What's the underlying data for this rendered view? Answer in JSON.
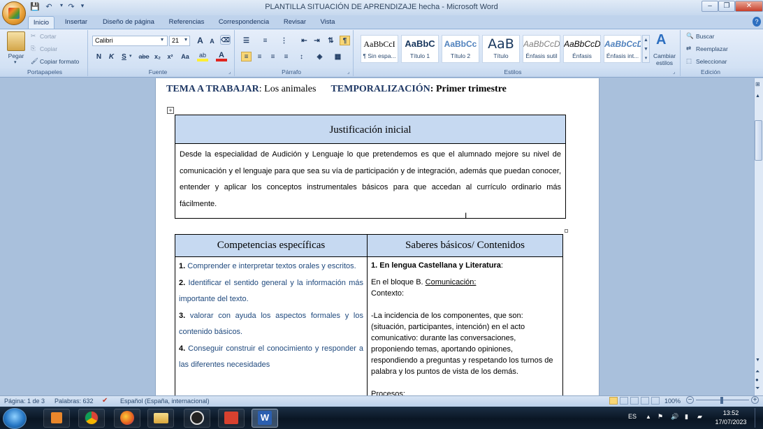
{
  "window": {
    "title": "PLANTILLA SITUACIÓN DE APRENDIZAJE hecha - Microsoft Word",
    "min_label": "–",
    "max_label": "❐",
    "close_label": "✕"
  },
  "tabs": [
    "Inicio",
    "Insertar",
    "Diseño de página",
    "Referencias",
    "Correspondencia",
    "Revisar",
    "Vista"
  ],
  "ribbon": {
    "portapapeles": {
      "paste": "Pegar",
      "cut": "Cortar",
      "copy": "Copiar",
      "format_painter": "Copiar formato",
      "label": "Portapapeles"
    },
    "fuente": {
      "font": "Calibri",
      "size": "21",
      "label": "Fuente",
      "bold": "N",
      "italic": "K",
      "underline": "S",
      "strike": "abe",
      "sub": "x₂",
      "sup": "x²",
      "case": "Aa",
      "grow": "A",
      "shrink": "A"
    },
    "parrafo": {
      "label": "Párrafo"
    },
    "estilos": {
      "label": "Estilos",
      "items": [
        {
          "preview": "AaBbCcI",
          "name": "¶ Sin espa..."
        },
        {
          "preview": "AaBbC",
          "name": "Título 1"
        },
        {
          "preview": "AaBbCc",
          "name": "Título 2"
        },
        {
          "preview": "AaB",
          "name": "Título"
        },
        {
          "preview": "AaBbCcD",
          "name": "Énfasis sutil"
        },
        {
          "preview": "AaBbCcD",
          "name": "Énfasis"
        },
        {
          "preview": "AaBbCcD",
          "name": "Énfasis int..."
        }
      ],
      "change_styles": "Cambiar estilos"
    },
    "edicion": {
      "find": "Buscar",
      "replace": "Reemplazar",
      "select": "Seleccionar",
      "label": "Edición"
    }
  },
  "document": {
    "header_line": {
      "topic_label": "TEMA A TRABAJAR",
      "topic_value": ": Los animales",
      "temp_label": "TEMPORALIZACIÓN",
      "temp_value": ": Primer trimestre"
    },
    "justificacion": {
      "title": "Justificación inicial",
      "body": "Desde la especialidad  de Audición y Lenguaje lo que pretendemos es que el alumnado mejore su nivel de comunicación y el lenguaje para que sea su vía de participación y de integración, además que puedan conocer, entender y aplicar los conceptos instrumentales básicos para que accedan al currículo ordinario más fácilmente."
    },
    "competencias": {
      "title": "Competencias específicas",
      "items": [
        {
          "num": "1.",
          "text": " Comprender e interpretar textos orales y escritos."
        },
        {
          "num": "2.",
          "text": " Identificar el sentido general y la información más importante del texto."
        },
        {
          "num": "3.",
          "text": " valorar con ayuda los aspectos formales y los contenido básicos."
        },
        {
          "num": "4.",
          "text": " Conseguir construir el conocimiento y responder a las diferentes necesidades"
        }
      ]
    },
    "saberes": {
      "title": "Saberes básicos/ Contenidos",
      "heading": "1. En lengua Castellana y Literatura",
      "heading_suffix": ":",
      "bloque_prefix": "En el bloque B. ",
      "bloque_link": "Comunicación:",
      "contexto": "Contexto:",
      "paragraph": "-La incidencia de los componentes,  que son: (situación, participantes, intención) en el acto comunicativo: durante las conversaciones, proponiendo temas, aportando opiniones, respondiendo a preguntas y respetando los turnos de palabra y los puntos de vista de los demás.",
      "procesos": "Procesos:"
    }
  },
  "status": {
    "page": "Página: 1 de 3",
    "words": "Palabras: 632",
    "language": "Español (España, internacional)",
    "zoom": "100%"
  },
  "taskbar": {
    "lang": "ES",
    "time": "13:52",
    "date": "17/07/2023"
  }
}
